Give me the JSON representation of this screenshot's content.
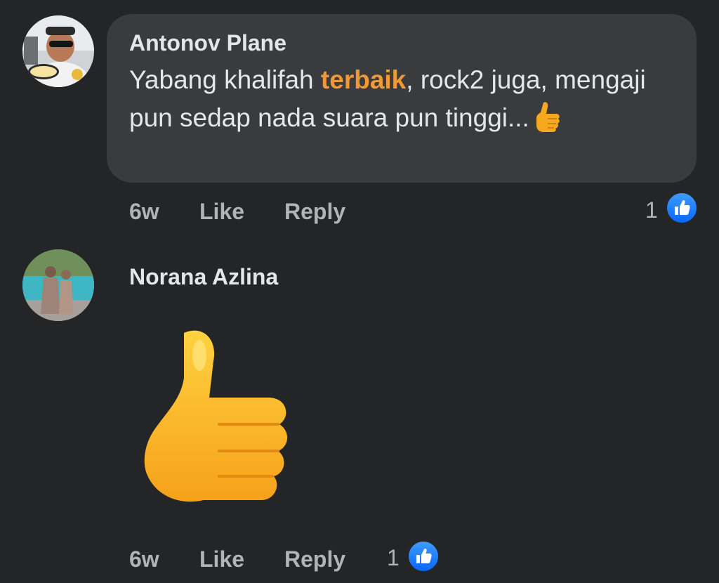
{
  "comments": [
    {
      "author": "Antonov Plane",
      "text_before": "Yabang khalifah ",
      "text_highlight": "terbaik",
      "text_after": ", rock2 juga, mengaji pun sedap nada suara pun tinggi...",
      "inline_emoji": "thumbs-up-icon",
      "time": "6w",
      "like_label": "Like",
      "reply_label": "Reply",
      "reaction_count": "1",
      "reaction_icon": "like-reaction-icon"
    },
    {
      "author": "Norana Azlina",
      "sticker": "thumbs-up-icon",
      "time": "6w",
      "like_label": "Like",
      "reply_label": "Reply",
      "reaction_count": "1",
      "reaction_icon": "like-reaction-icon"
    }
  ],
  "colors": {
    "background": "#242526",
    "bubble": "#3a3b3c",
    "highlight": "#f09a37",
    "secondary_text": "#b0b3b8",
    "like_blue": "#0866ff"
  }
}
